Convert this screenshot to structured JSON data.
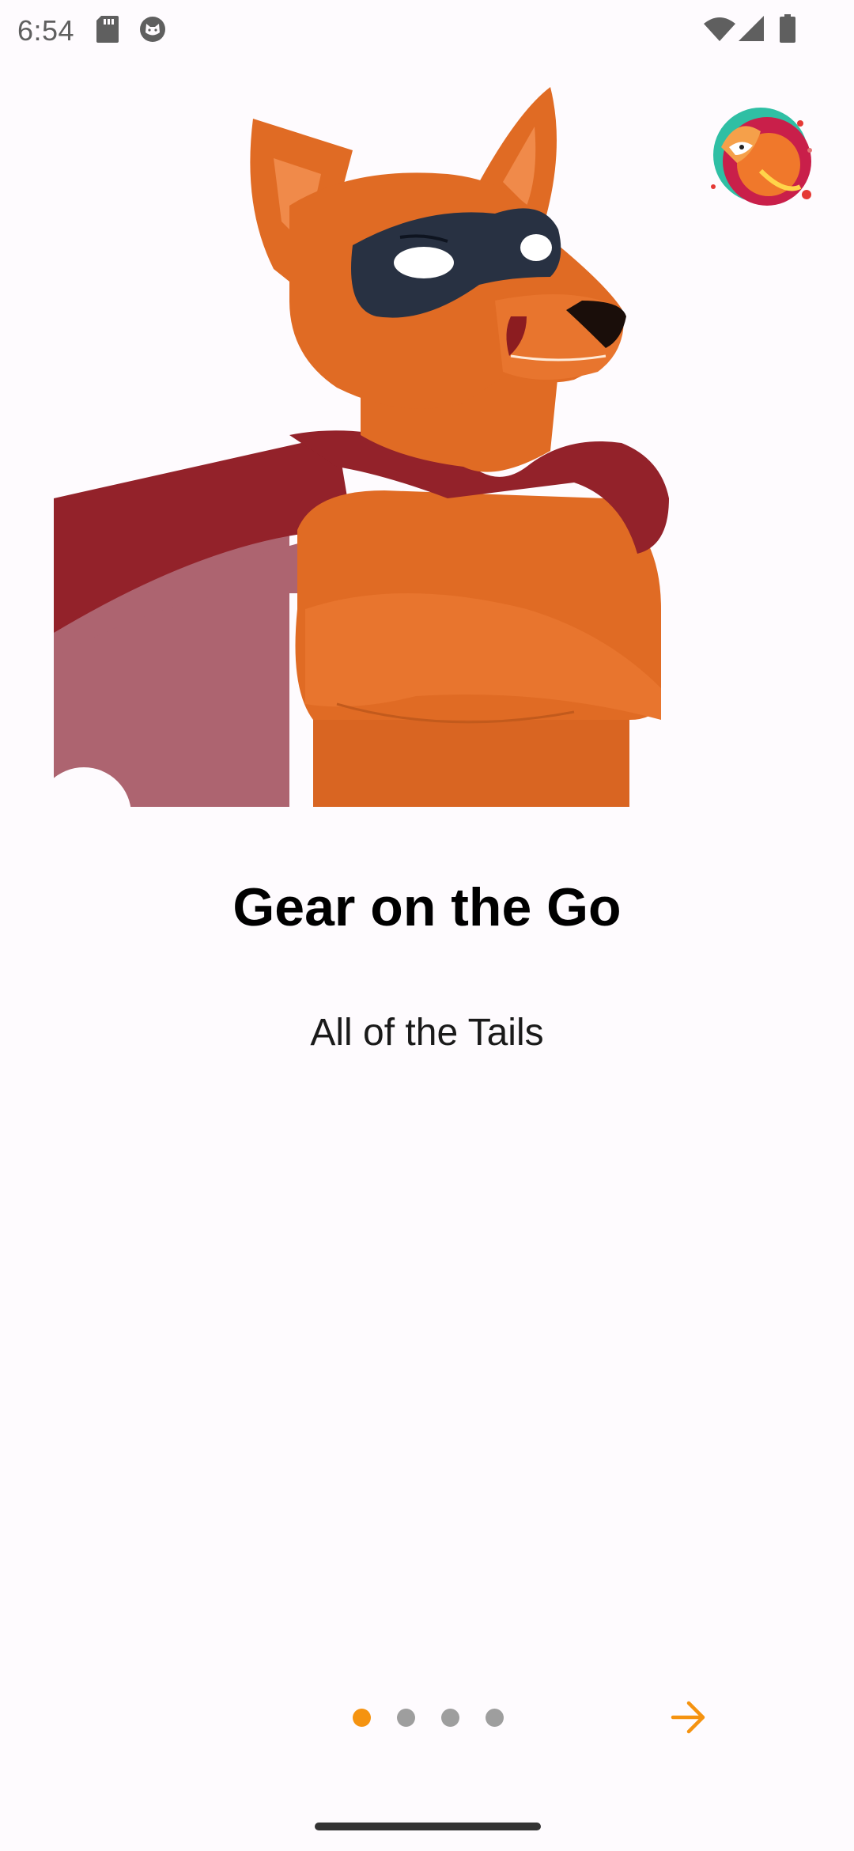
{
  "status_bar": {
    "time": "6:54",
    "left_icons": [
      "sd-card-icon",
      "cat-notification-icon"
    ],
    "right_icons": [
      "wifi-icon",
      "signal-icon",
      "battery-icon"
    ]
  },
  "hero": {
    "image": "masked-fox-superhero-illustration",
    "logo": "fox-logo-icon"
  },
  "onboarding": {
    "title": "Gear on the Go",
    "subtitle": "All of the Tails"
  },
  "pager": {
    "page_count": 4,
    "current_page": 1
  },
  "next_button": {
    "icon": "arrow-right-icon"
  },
  "colors": {
    "accent": "#f59310",
    "inactive_dot": "#9e9e9e",
    "background": "#fefbfe"
  }
}
